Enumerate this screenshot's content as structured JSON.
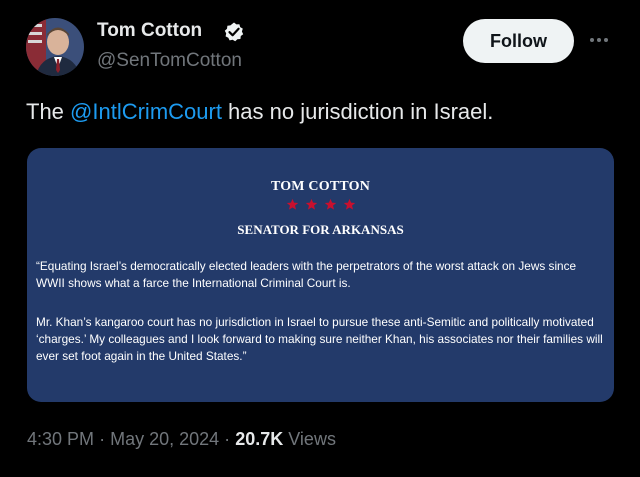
{
  "author": {
    "display_name": "Tom Cotton",
    "handle": "@SenTomCotton",
    "verified": true,
    "verified_color": "#1d9bf0"
  },
  "actions": {
    "follow_label": "Follow",
    "more_icon": "more-horizontal-icon"
  },
  "tweet": {
    "text_before": "The ",
    "mention": "@IntlCrimCourt",
    "text_after": " has no jurisdiction in Israel."
  },
  "statement_card": {
    "title": "TOM COTTON",
    "stars_count": 4,
    "star_color": "#c8102e",
    "subtitle": "SENATOR FOR ARKANSAS",
    "paragraph_1": "“Equating Israel’s democratically elected leaders with the perpetrators of the worst attack on Jews since WWII shows what a farce the International Criminal Court is.",
    "paragraph_2": "Mr. Khan’s kangaroo court has no jurisdiction in Israel to pursue these anti-Semitic and politically motivated ‘charges.’ My colleagues and I look forward to making sure neither Khan, his associates nor their families will ever set foot again in the United States.”",
    "background_color": "#233a6a"
  },
  "meta": {
    "time": "4:30 PM",
    "separator": "·",
    "date": "May 20, 2024",
    "views_count": "20.7K",
    "views_label": "Views"
  },
  "colors": {
    "background": "#000000",
    "text_primary": "#e7e9ea",
    "text_secondary": "#71767b",
    "link": "#1d9bf0"
  }
}
